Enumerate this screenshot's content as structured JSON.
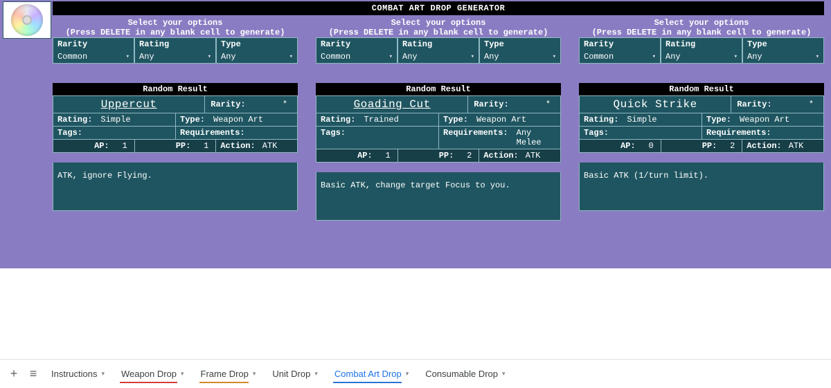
{
  "title": "COMBAT ART DROP GENERATOR",
  "options_header_1": "Select your options",
  "options_header_2": "(Press DELETE in any blank cell to generate)",
  "option_labels": {
    "rarity": "Rarity",
    "rating": "Rating",
    "type": "Type"
  },
  "result_header": "Random Result",
  "field_labels": {
    "rarity": "Rarity:",
    "rating": "Rating:",
    "type": "Type:",
    "tags": "Tags:",
    "requirements": "Requirements:",
    "ap": "AP:",
    "pp": "PP:",
    "action": "Action:"
  },
  "panels": [
    {
      "options": {
        "rarity": "Common",
        "rating": "Any",
        "type": "Any"
      },
      "result": {
        "name": "Uppercut",
        "name_underline": true,
        "rarity": "*",
        "rating": "Simple",
        "type": "Weapon Art",
        "tags": "",
        "requirements": "",
        "ap": "1",
        "pp": "1",
        "action": "ATK",
        "description": "ATK, ignore Flying."
      }
    },
    {
      "options": {
        "rarity": "Common",
        "rating": "Any",
        "type": "Any"
      },
      "result": {
        "name": "Goading Cut",
        "name_underline": true,
        "rarity": "*",
        "rating": "Trained",
        "type": "Weapon Art",
        "tags": "",
        "requirements": "Any Melee",
        "ap": "1",
        "pp": "2",
        "action": "ATK",
        "description": "Basic ATK, change target Focus to you."
      }
    },
    {
      "options": {
        "rarity": "Common",
        "rating": "Any",
        "type": "Any"
      },
      "result": {
        "name": "Quick Strike",
        "name_underline": false,
        "rarity": "*",
        "rating": "Simple",
        "type": "Weapon Art",
        "tags": "",
        "requirements": "",
        "ap": "0",
        "pp": "2",
        "action": "ATK",
        "description": "Basic ATK (1/turn limit)."
      }
    }
  ],
  "tabs": [
    {
      "label": "Instructions",
      "accent": "",
      "active": false
    },
    {
      "label": "Weapon Drop",
      "accent": "red",
      "active": false
    },
    {
      "label": "Frame Drop",
      "accent": "orange",
      "active": false
    },
    {
      "label": "Unit Drop",
      "accent": "",
      "active": false
    },
    {
      "label": "Combat Art Drop",
      "accent": "blue",
      "active": true
    },
    {
      "label": "Consumable Drop",
      "accent": "",
      "active": false
    }
  ],
  "icons": {
    "add": "+",
    "menu": "≡",
    "chev": "▾"
  }
}
